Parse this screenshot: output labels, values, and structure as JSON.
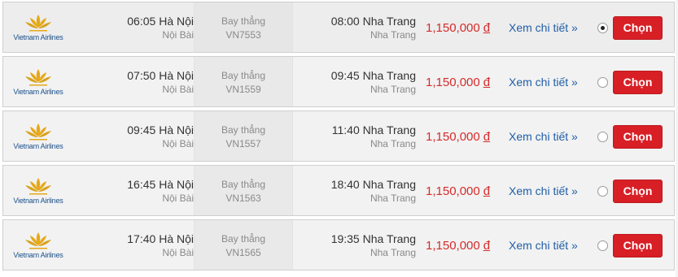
{
  "flights": [
    {
      "airline": "Vietnam Airlines",
      "dep_time": "06:05",
      "dep_city": "Hà Nội",
      "dep_airport": "Nội Bài",
      "flight_type": "Bay thẳng",
      "flight_no": "VN7553",
      "arr_time": "08:00",
      "arr_city": "Nha Trang",
      "arr_airport": "Nha Trang",
      "price": "1,150,000",
      "currency": "đ",
      "detail_label": "Xem chi tiết »",
      "selected": true,
      "button_label": "Chọn"
    },
    {
      "airline": "Vietnam Airlines",
      "dep_time": "07:50",
      "dep_city": "Hà Nội",
      "dep_airport": "Nội Bài",
      "flight_type": "Bay thẳng",
      "flight_no": "VN1559",
      "arr_time": "09:45",
      "arr_city": "Nha Trang",
      "arr_airport": "Nha Trang",
      "price": "1,150,000",
      "currency": "đ",
      "detail_label": "Xem chi tiết »",
      "selected": false,
      "button_label": "Chọn"
    },
    {
      "airline": "Vietnam Airlines",
      "dep_time": "09:45",
      "dep_city": "Hà Nội",
      "dep_airport": "Nội Bài",
      "flight_type": "Bay thẳng",
      "flight_no": "VN1557",
      "arr_time": "11:40",
      "arr_city": "Nha Trang",
      "arr_airport": "Nha Trang",
      "price": "1,150,000",
      "currency": "đ",
      "detail_label": "Xem chi tiết »",
      "selected": false,
      "button_label": "Chọn"
    },
    {
      "airline": "Vietnam Airlines",
      "dep_time": "16:45",
      "dep_city": "Hà Nội",
      "dep_airport": "Nội Bài",
      "flight_type": "Bay thẳng",
      "flight_no": "VN1563",
      "arr_time": "18:40",
      "arr_city": "Nha Trang",
      "arr_airport": "Nha Trang",
      "price": "1,150,000",
      "currency": "đ",
      "detail_label": "Xem chi tiết »",
      "selected": false,
      "button_label": "Chọn"
    },
    {
      "airline": "Vietnam Airlines",
      "dep_time": "17:40",
      "dep_city": "Hà Nội",
      "dep_airport": "Nội Bài",
      "flight_type": "Bay thẳng",
      "flight_no": "VN1565",
      "arr_time": "19:35",
      "arr_city": "Nha Trang",
      "arr_airport": "Nha Trang",
      "price": "1,150,000",
      "currency": "đ",
      "detail_label": "Xem chi tiết »",
      "selected": false,
      "button_label": "Chọn"
    }
  ],
  "icons": {
    "logo": "vietnam-airlines-lotus-logo",
    "radio": "radio-button"
  },
  "colors": {
    "brand_gold": "#e6a817",
    "brand_blue": "#1a4f8b",
    "price_red": "#d52b2b",
    "button_red": "#d81f26",
    "link_blue": "#1f5ea8",
    "row_bg": "#f2f2f2"
  }
}
